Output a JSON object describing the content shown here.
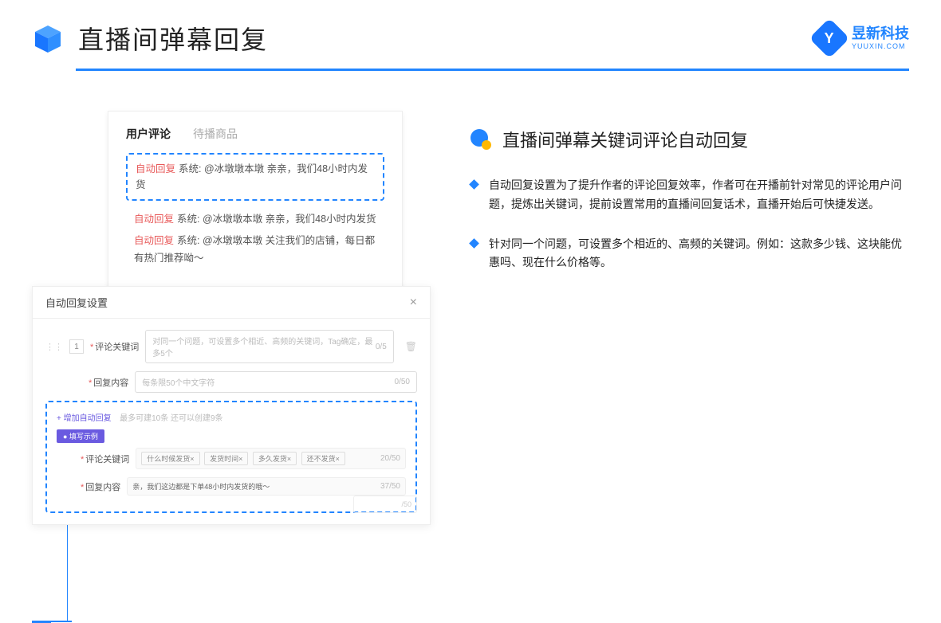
{
  "header": {
    "title": "直播间弹幕回复",
    "brand_name": "昱新科技",
    "brand_url": "YUUXIN.COM"
  },
  "comment_card": {
    "tab_active": "用户评论",
    "tab_inactive": "待播商品",
    "auto_reply_tag": "自动回复",
    "highlighted": "系统: @冰墩墩本墩 亲亲，我们48小时内发货",
    "line2": "系统: @冰墩墩本墩 亲亲，我们48小时内发货",
    "line3": "系统: @冰墩墩本墩 关注我们的店铺，每日都有热门推荐呦～"
  },
  "settings": {
    "title": "自动回复设置",
    "row_num": "1",
    "keyword_label": "评论关键词",
    "keyword_placeholder": "对同一个问题，可设置多个相近、高频的关键词，Tag确定，最多5个",
    "keyword_count": "0/5",
    "content_label": "回复内容",
    "content_placeholder": "每条限50个中文字符",
    "content_count": "0/50",
    "add_link": "+ 增加自动回复",
    "add_hint": "最多可建10条 还可以创建9条",
    "example_badge": "● 填写示例",
    "ex_keyword_label": "评论关键词",
    "ex_tags": [
      "什么时候发货×",
      "发货时间×",
      "多久发货×",
      "还不发货×"
    ],
    "ex_keyword_count": "20/50",
    "ex_content_label": "回复内容",
    "ex_content_value": "亲，我们这边都是下单48小时内发货的哦～",
    "ex_content_count": "37/50",
    "stub_count": "/50"
  },
  "right": {
    "section_title": "直播间弹幕关键词评论自动回复",
    "bullet1": "自动回复设置为了提升作者的评论回复效率，作者可在开播前针对常见的评论用户问题，提炼出关键词，提前设置常用的直播间回复话术，直播开始后可快捷发送。",
    "bullet2": "针对同一个问题，可设置多个相近的、高频的关键词。例如：这款多少钱、这块能优惠吗、现在什么价格等。"
  }
}
